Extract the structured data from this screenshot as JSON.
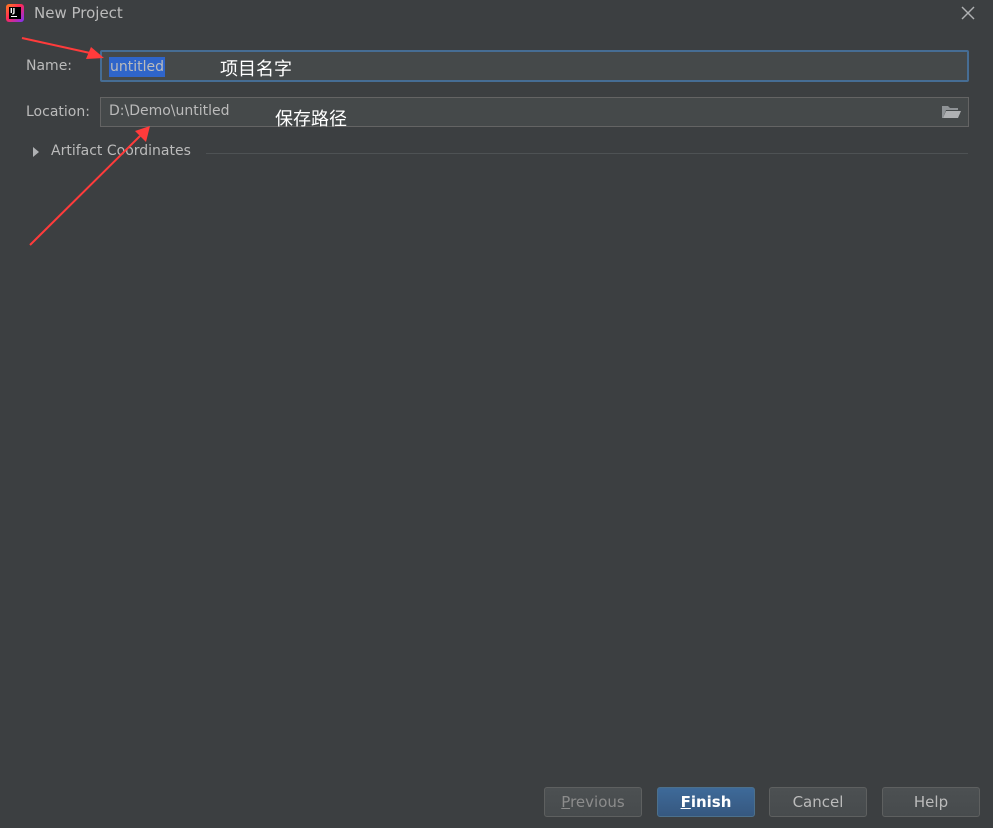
{
  "window": {
    "title": "New Project"
  },
  "form": {
    "name_label": "Name:",
    "name_value": "untitled",
    "location_label": "Location:",
    "location_value": "D:\\Demo\\untitled",
    "artifact_section": "Artifact Coordinates"
  },
  "annotations": {
    "name_note": "项目名字",
    "location_note": "保存路径",
    "arrow_color": "#ff3b3b"
  },
  "buttons": {
    "previous_mnemonic": "P",
    "previous_rest": "revious",
    "finish_mnemonic": "F",
    "finish_rest": "inish",
    "cancel": "Cancel",
    "help": "Help"
  },
  "icons": {
    "app": "intellij-idea-icon",
    "close": "close-icon",
    "folder": "folder-open-icon",
    "expand": "triangle-right-icon"
  },
  "colors": {
    "background": "#3c3f41",
    "field_background": "#45494a",
    "focus_border": "#466d94",
    "selection": "#2f65ca",
    "primary_button": "#365880"
  }
}
